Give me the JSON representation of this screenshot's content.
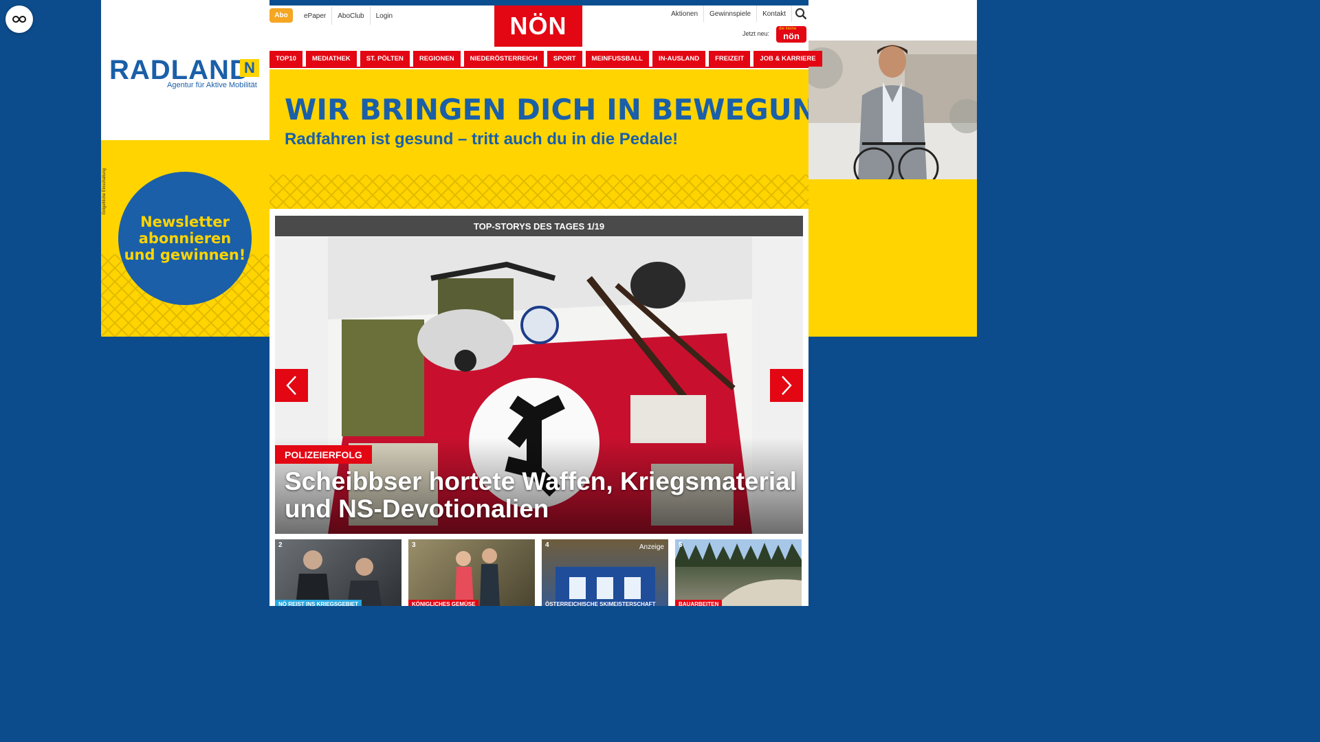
{
  "corner": {
    "icon": "infinity-icon"
  },
  "ad_left": {
    "logo_main": "RADLAND",
    "logo_badge": "N",
    "logo_sub": "Agentur für Aktive Mobilität",
    "newsletter": "Newsletter\nabonnieren\nund gewinnen!",
    "note": "Entgeltliche Einschaltung"
  },
  "header": {
    "abo": "Abo",
    "links": [
      "ePaper",
      "AboClub",
      "Login"
    ],
    "brand": "NÖN",
    "right_links": [
      "Aktionen",
      "Gewinnspiele",
      "Kontakt"
    ],
    "jetzt_neu": "Jetzt neu:",
    "jetzt_badge_small": "die kleine",
    "jetzt_badge": "nön"
  },
  "nav": [
    "TOP10",
    "MEDIATHEK",
    "ST. PÖLTEN",
    "REGIONEN",
    "NIEDERÖSTERREICH",
    "SPORT",
    "MEINFUSSBALL",
    "IN-AUSLAND",
    "FREIZEIT",
    "JOB & KARRIERE"
  ],
  "banner": {
    "headline": "WIR BRINGEN DICH IN BEWEGUNG.",
    "subline": "Radfahren ist gesund – tritt auch du in die Pedale!"
  },
  "slider": {
    "header": "TOP-STORYS DES TAGES 1/19",
    "kicker": "POLIZEIERFOLG",
    "headline": "Scheibbser hortete Waffen, Kriegsmaterial und NS-Devotionalien"
  },
  "thumbs": [
    {
      "num": "2",
      "label": "NÖ REIST INS KRIEGSGEBIET",
      "ad": "",
      "label_color": "#29a8e0"
    },
    {
      "num": "3",
      "label": "KÖNIGLICHES GEMÜSE",
      "ad": "",
      "label_color": "#e30613"
    },
    {
      "num": "4",
      "label": "ÖSTERREICHISCHE SKIMEISTERSCHAFT",
      "ad": "Anzeige",
      "label_color": "transparent"
    },
    {
      "num": "5",
      "label": "BAUARBEITEN",
      "ad": "",
      "label_color": "#e30613"
    }
  ],
  "colors": {
    "brand_red": "#e30613",
    "ad_yellow": "#ffd400",
    "ad_blue": "#1a5fa8",
    "background": "#0c4c8c"
  }
}
